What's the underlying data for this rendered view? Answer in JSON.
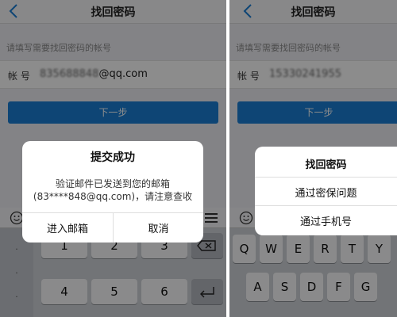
{
  "left_screen": {
    "title": "找回密码",
    "hint": "请填写需要找回密码的帐号",
    "account_label": "帐 号",
    "account_masked": "835688848",
    "account_domain": "@qq.com",
    "next_button": "下一步",
    "dialog": {
      "title": "提交成功",
      "message_line1": "验证邮件已发送到您的邮箱",
      "message_line2": "(83****848@qq.com)，请注意查收",
      "confirm": "进入邮箱",
      "cancel": "取消"
    },
    "keyboard": {
      "keys": [
        "1",
        "2",
        "3",
        "4",
        "5",
        "6"
      ]
    }
  },
  "right_screen": {
    "title": "找回密码",
    "hint": "请填写需要找回密码的帐号",
    "account_label": "帐 号",
    "account_masked": "15330241955",
    "next_button": "下一步",
    "action_sheet": {
      "title": "找回密码",
      "options": [
        "通过密保问题",
        "通过手机号"
      ]
    },
    "keyboard": {
      "row1": [
        "Q",
        "W",
        "E",
        "R",
        "T",
        "Y"
      ],
      "row2": [
        "A",
        "S",
        "D",
        "F",
        "G"
      ]
    }
  },
  "colors": {
    "accent": "#1a7fd6",
    "overlay": "rgba(0,0,0,0.45)"
  }
}
